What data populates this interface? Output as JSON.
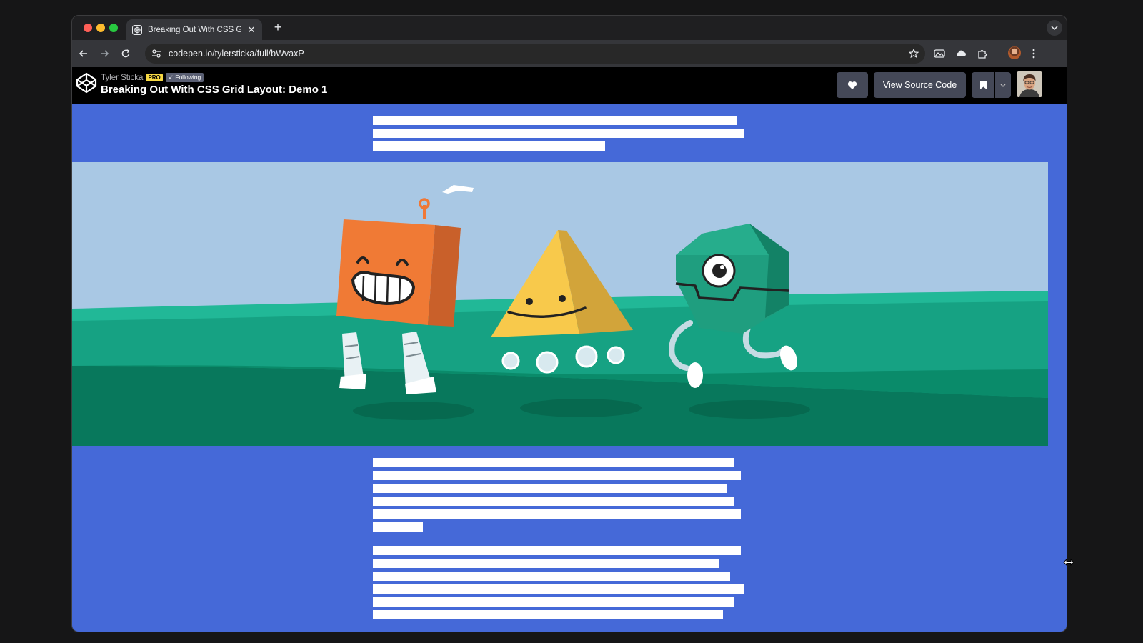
{
  "browser": {
    "tab_title": "Breaking Out With CSS Grid L",
    "new_tab_label": "+",
    "close_label": "✕",
    "url": "codepen.io/tylersticka/full/bWvaxP"
  },
  "codepen": {
    "username": "Tyler Sticka",
    "pro_badge": "PRO",
    "following_badge": "✓ Following",
    "pen_title": "Breaking Out With CSS Grid Layout: Demo 1",
    "view_source_label": "View Source Code"
  },
  "content": {
    "intro_line_count": 3,
    "paragraph1_line_count": 6,
    "paragraph2_line_count": 6,
    "hero_image": "three cartoon robots: orange box, yellow pyramid, green hexagon"
  },
  "colors": {
    "page_background": "#4569d8",
    "text_placeholder": "#ffffff",
    "sky": "#a9c8e4",
    "grass_light": "#1fb494",
    "grass_dark": "#08785c"
  }
}
